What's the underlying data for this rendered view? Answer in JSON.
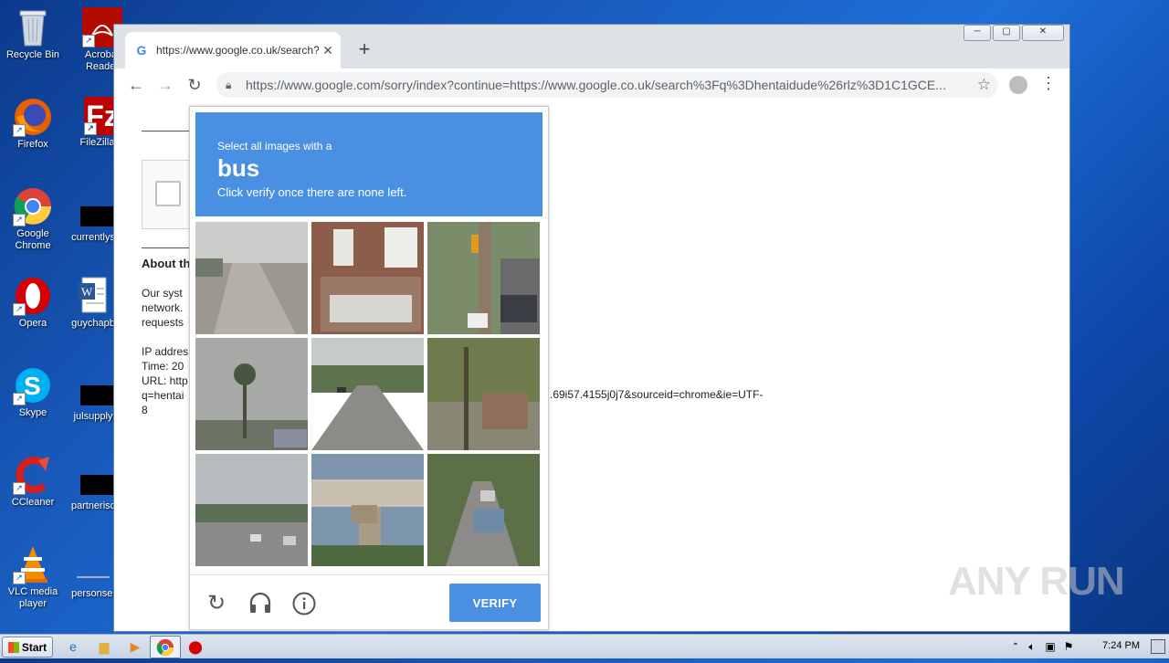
{
  "desktop": {
    "icons": [
      {
        "label": "Recycle Bin"
      },
      {
        "label": "Acrobat Reader"
      },
      {
        "label": "Firefox"
      },
      {
        "label": "FileZilla C"
      },
      {
        "label": "Google Chrome"
      },
      {
        "label": "currentlys"
      },
      {
        "label": "Opera"
      },
      {
        "label": "guychapb"
      },
      {
        "label": "Skype"
      },
      {
        "label": "julsupply"
      },
      {
        "label": "CCleaner"
      },
      {
        "label": "partnerisc"
      },
      {
        "label": "VLC media player"
      },
      {
        "label": "personsel"
      }
    ]
  },
  "browser": {
    "tab_title": "https://www.google.co.uk/search?q",
    "new_tab": "+",
    "window_buttons": {
      "minimize": "─",
      "restore": "▢",
      "close": "✕"
    },
    "url": "https://www.google.com/sorry/index?continue=https://www.google.co.uk/search%3Fq%3Dhentaidude%26rlz%3D1C1GCE..."
  },
  "page": {
    "about_heading": "About th",
    "body_lines": [
      "Our syst",
      "network.",
      "requests"
    ],
    "info_lines": [
      "IP addres",
      "Time: 20",
      "URL: http",
      "q=hentai",
      "8"
    ],
    "url_tail": ".69i57.4155j0j7&sourceid=chrome&ie=UTF-"
  },
  "captcha": {
    "instruction_small": "Select all images with a",
    "target": "bus",
    "instruction_sub": "Click verify once there are none left.",
    "verify_label": "VERIFY",
    "icons": [
      "reload-icon",
      "headphones-icon",
      "info-icon"
    ]
  },
  "watermark": "ANY RUN",
  "taskbar": {
    "start_label": "Start",
    "clock": "7:24 PM"
  }
}
